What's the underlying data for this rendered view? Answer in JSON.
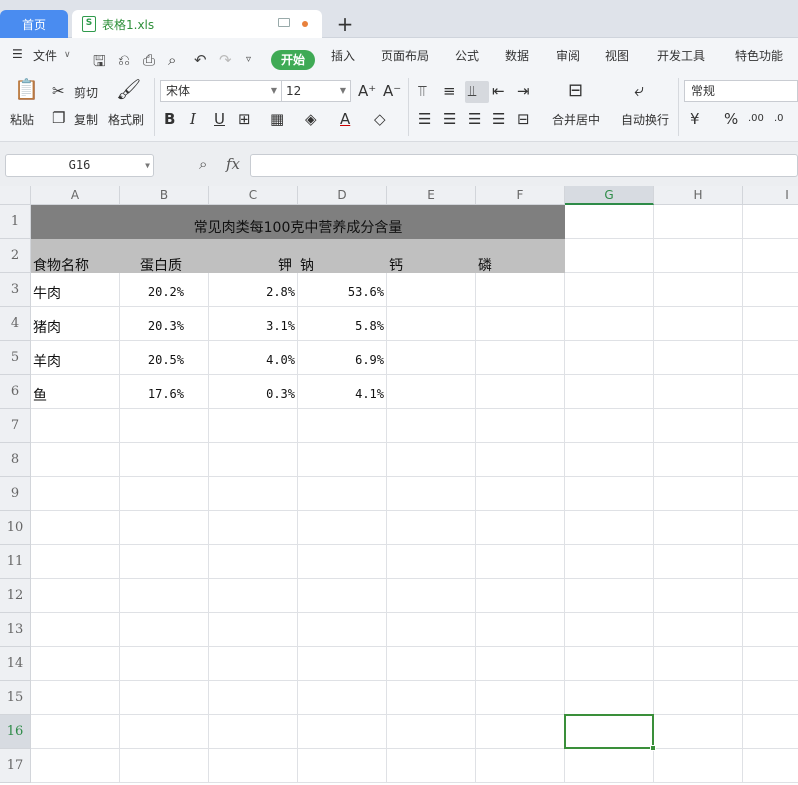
{
  "tabs": {
    "home": "首页",
    "file": "表格1.xls",
    "add": "+"
  },
  "menu": {
    "file": "文件",
    "start": "开始",
    "insert": "插入",
    "page_layout": "页面布局",
    "formula": "公式",
    "data": "数据",
    "review": "审阅",
    "view": "视图",
    "developer": "开发工具",
    "special": "特色功能"
  },
  "ribbon": {
    "paste": "粘贴",
    "cut": "剪切",
    "copy": "复制",
    "format_painter": "格式刷",
    "font_name": "宋体",
    "font_size": "12",
    "merge_center": "合并居中",
    "wrap_text": "自动换行",
    "number_format": "常规"
  },
  "formula_bar": {
    "name_box": "G16",
    "fx": "fx",
    "formula": ""
  },
  "columns": [
    "A",
    "B",
    "C",
    "D",
    "E",
    "F",
    "G",
    "H",
    "I"
  ],
  "selected_column": "G",
  "rows": [
    "1",
    "2",
    "3",
    "4",
    "5",
    "6",
    "7",
    "8",
    "9",
    "10",
    "11",
    "12",
    "13",
    "14",
    "15",
    "16",
    "17"
  ],
  "selected_row": "16",
  "sheet": {
    "title": "常见肉类每100克中营养成分含量",
    "headers": {
      "name": "食物名称",
      "protein": "蛋白质",
      "potassium": "钾",
      "sodium": "钠",
      "calcium": "钙",
      "phosphorus": "磷"
    },
    "data_rows": [
      {
        "name": "牛肉",
        "protein": "20.2%",
        "potassium": "2.8%",
        "sodium": "53.6%"
      },
      {
        "name": "猪肉",
        "protein": "20.3%",
        "potassium": "3.1%",
        "sodium": "5.8%"
      },
      {
        "name": "羊肉",
        "protein": "20.5%",
        "potassium": "4.0%",
        "sodium": "6.9%"
      },
      {
        "name": "鱼",
        "protein": "17.6%",
        "potassium": "0.3%",
        "sodium": "4.1%"
      }
    ]
  },
  "colors": {
    "accent": "#3faa55",
    "home_tab": "#4a8cf0",
    "title_fill": "#7f7f7f",
    "header_fill": "#c0c0c0"
  }
}
